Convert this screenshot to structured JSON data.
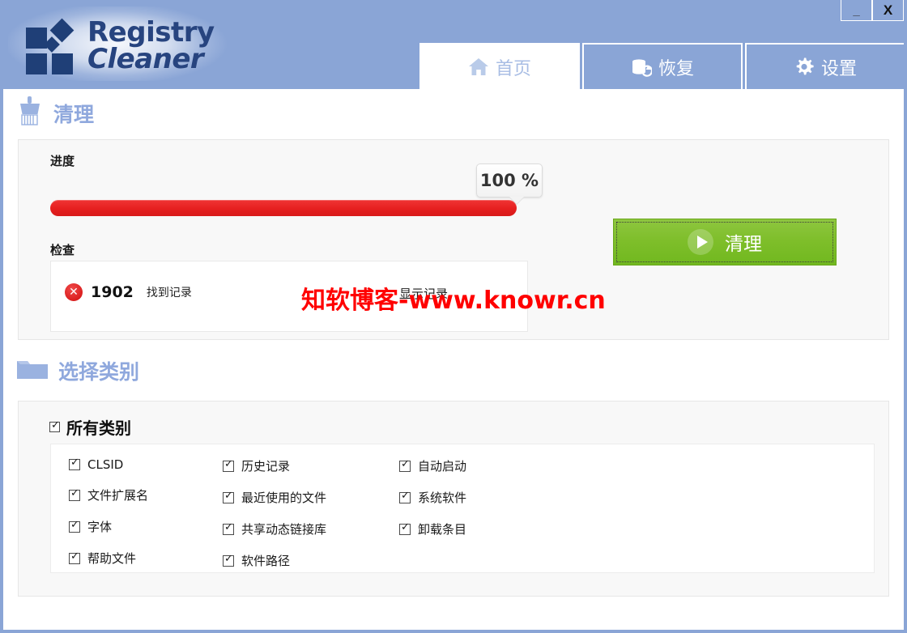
{
  "window": {
    "minimize_label": "_",
    "close_label": "X"
  },
  "brand": {
    "line1": "Registry",
    "line2": "Cleaner"
  },
  "tabs": [
    {
      "label": "首页",
      "icon": "home-icon",
      "active": true
    },
    {
      "label": "恢复",
      "icon": "restore-database-icon",
      "active": false
    },
    {
      "label": "设置",
      "icon": "gear-icon",
      "active": false
    }
  ],
  "clean_section": {
    "title": "清理",
    "icon": "brush-icon",
    "progress_label": "进度",
    "progress_value": "100 %",
    "progress_percent": 100,
    "check_label": "检查",
    "result_icon": "error-circle-icon",
    "result_count": "1902",
    "result_text": "找到记录",
    "show_records_label": "显示记录",
    "clean_button_label": "清理",
    "clean_button_icon": "play-icon",
    "clean_button_color": "#7ebe2a",
    "progress_bar_color": "#e62020"
  },
  "category_section": {
    "title": "选择类别",
    "icon": "folder-icon",
    "all_label": "所有类别",
    "all_checked": true,
    "columns": [
      [
        {
          "label": "CLSID",
          "checked": true
        },
        {
          "label": "文件扩展名",
          "checked": true
        },
        {
          "label": "字体",
          "checked": true
        },
        {
          "label": "帮助文件",
          "checked": true
        }
      ],
      [
        {
          "label": "历史记录",
          "checked": true
        },
        {
          "label": "最近使用的文件",
          "checked": true
        },
        {
          "label": "共享动态链接库",
          "checked": true
        },
        {
          "label": "软件路径",
          "checked": true
        }
      ],
      [
        {
          "label": "自动启动",
          "checked": true
        },
        {
          "label": "系统软件",
          "checked": true
        },
        {
          "label": "卸载条目",
          "checked": true
        }
      ]
    ]
  },
  "watermark": {
    "text": "知软博客-www.knowr.cn",
    "color": "#ff0000"
  }
}
